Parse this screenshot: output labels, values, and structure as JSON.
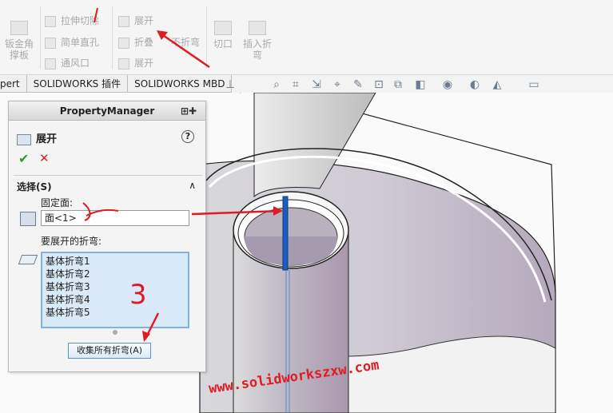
{
  "ribbon": {
    "big_left": {
      "line1": "钣金角",
      "line2": "撑板"
    },
    "col1": [
      "拉伸切除",
      "简单直孔",
      "通风口"
    ],
    "col2": [
      "展开",
      "折叠",
      "展开"
    ],
    "col2_extra": "不折弯",
    "cut_label": "切口",
    "insert_bends": {
      "line1": "插入折",
      "line2": "弯"
    }
  },
  "tabs": [
    "pert",
    "SOLIDWORKS 插件",
    "SOLIDWORKS MBD"
  ],
  "property_manager": {
    "header": "PropertyManager",
    "feature_title": "展开",
    "help": "?",
    "ok": "✔",
    "cancel": "✕",
    "section_title": "选择(S)",
    "fixed_face_label": "固定面:",
    "fixed_face_value": "面<1>",
    "bends_label": "要展开的折弯:",
    "bends": [
      "基体折弯1",
      "基体折弯2",
      "基体折弯3",
      "基体折弯4",
      "基体折弯5"
    ],
    "collect_button": "收集所有折弯(A)"
  },
  "watermark": "www.solidworkszxw.com",
  "annotation_number": "3",
  "colors": {
    "accent": "#e01b24",
    "selection": "#1a5fc0",
    "part_face": "#c8c3cc"
  }
}
